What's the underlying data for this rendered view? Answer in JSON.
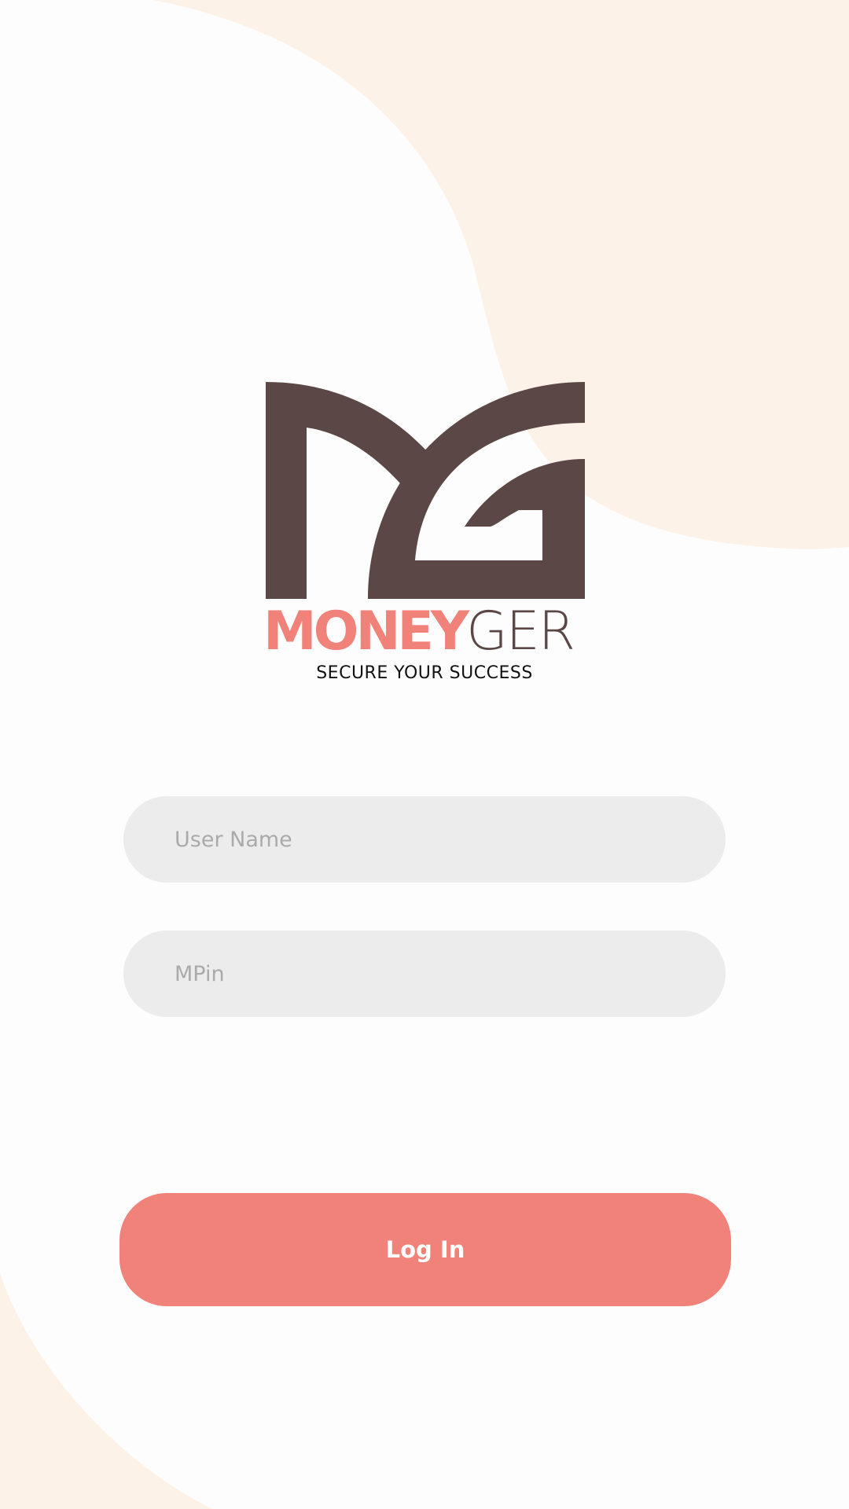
{
  "app": {
    "brand_primary": "MONEY",
    "brand_secondary": "GER",
    "tagline": "SECURE YOUR SUCCESS"
  },
  "form": {
    "username": {
      "placeholder": "User Name",
      "value": ""
    },
    "mpin": {
      "placeholder": "MPin",
      "value": ""
    },
    "login_label": "Log In"
  },
  "colors": {
    "accent": "#f08279",
    "logo_dark": "#5b4745",
    "field_bg": "#ececec",
    "background": "#fefdfd",
    "blob": "#fdf2e8"
  }
}
